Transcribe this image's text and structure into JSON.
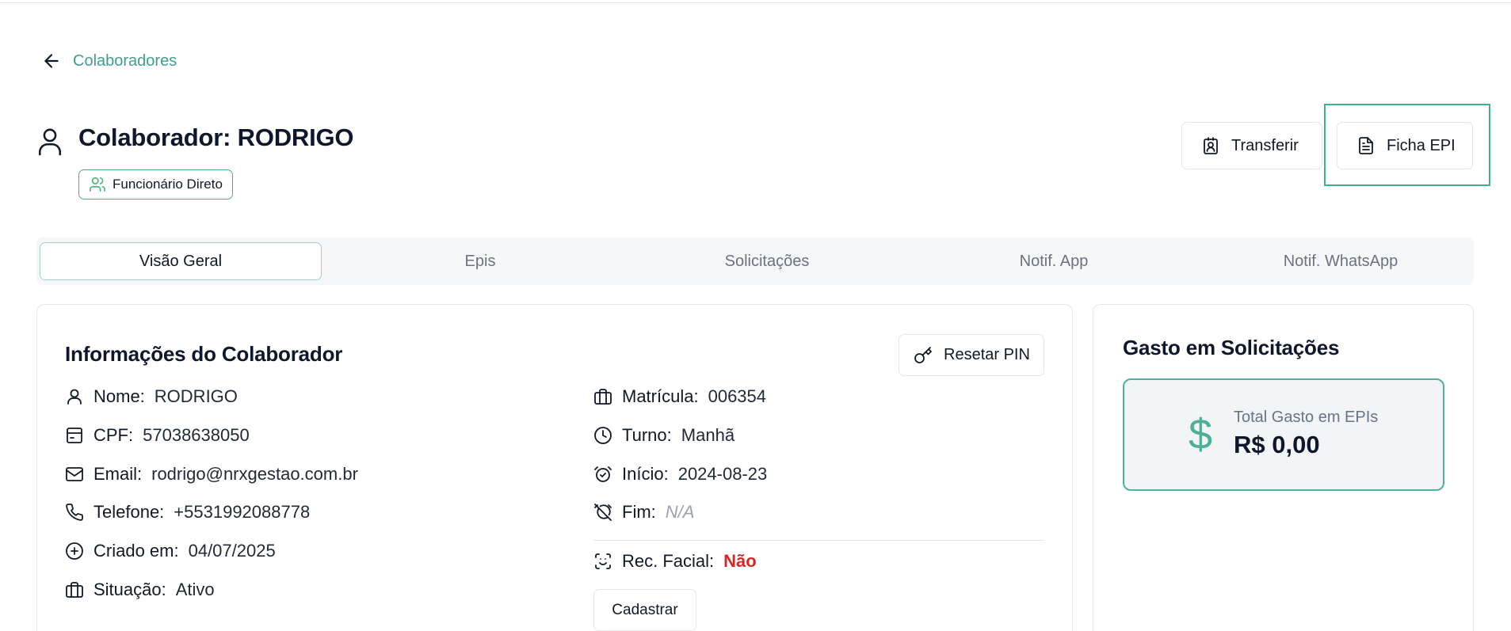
{
  "back": {
    "label": "Colaboradores"
  },
  "header": {
    "title": "Colaborador: RODRIGO",
    "badge": "Funcionário Direto",
    "transfer_label": "Transferir",
    "ficha_label": "Ficha EPI"
  },
  "tabs": [
    {
      "label": "Visão Geral",
      "active": true
    },
    {
      "label": "Epis"
    },
    {
      "label": "Solicitações"
    },
    {
      "label": "Notif. App"
    },
    {
      "label": "Notif. WhatsApp"
    }
  ],
  "info": {
    "title": "Informações do Colaborador",
    "reset_pin_label": "Resetar PIN",
    "left": [
      {
        "label": "Nome:",
        "value": "RODRIGO",
        "icon": "user-icon"
      },
      {
        "label": "CPF:",
        "value": "57038638050",
        "icon": "id-card-icon"
      },
      {
        "label": "Email:",
        "value": "rodrigo@nrxgestao.com.br",
        "icon": "mail-icon"
      },
      {
        "label": "Telefone:",
        "value": "+5531992088778",
        "icon": "phone-icon"
      },
      {
        "label": "Criado em:",
        "value": "04/07/2025",
        "icon": "plus-circle-icon"
      },
      {
        "label": "Situação:",
        "value": "Ativo",
        "icon": "briefcase-icon"
      }
    ],
    "right": [
      {
        "label": "Matrícula:",
        "value": "006354",
        "icon": "briefcase-icon"
      },
      {
        "label": "Turno:",
        "value": "Manhã",
        "icon": "clock-icon"
      },
      {
        "label": "Início:",
        "value": "2024-08-23",
        "icon": "alarm-check-icon"
      },
      {
        "label": "Fim:",
        "value": "N/A",
        "icon": "alarm-off-icon"
      }
    ],
    "facial": {
      "label": "Rec. Facial:",
      "value": "Não",
      "icon": "face-scan-icon"
    },
    "cadastrar_label": "Cadastrar"
  },
  "gasto": {
    "title": "Gasto em Solicitações",
    "symbol": "$",
    "label": "Total Gasto em EPIs",
    "value": "R$ 0,00"
  },
  "colors": {
    "accent": "#3f9f8a",
    "badge_border": "#4fb27c",
    "danger": "#dc2626",
    "focus_ring": "#3fb28c"
  }
}
